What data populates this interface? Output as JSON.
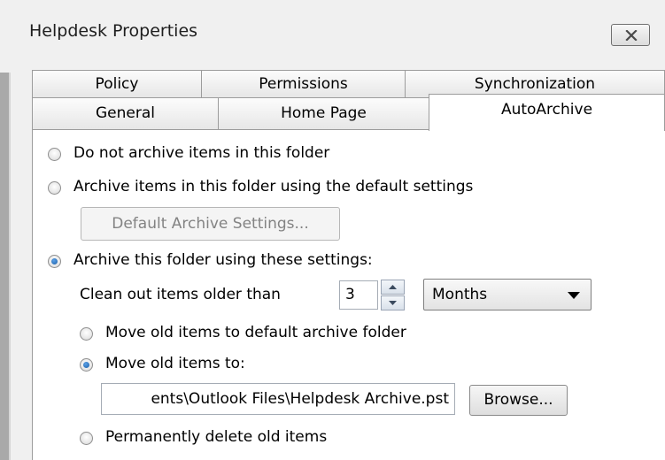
{
  "window": {
    "title": "Helpdesk Properties",
    "close_icon": "close-icon"
  },
  "tabs": {
    "row1": [
      "Policy",
      "Permissions",
      "Synchronization"
    ],
    "row2": [
      "General",
      "Home Page",
      "AutoArchive"
    ],
    "active": "AutoArchive"
  },
  "autoarchive": {
    "option_no_archive": "Do not archive items in this folder",
    "option_default": "Archive items in this folder using the default settings",
    "default_settings_button": "Default Archive Settings...",
    "option_custom": "Archive this folder using these settings:",
    "clean_out_label": "Clean out items older than",
    "age_value": "3",
    "age_unit": "Months",
    "move_default_label": "Move old items to default archive folder",
    "move_to_label": "Move old items to:",
    "archive_path": "ents\\Outlook Files\\Helpdesk Archive.pst",
    "browse_button": "Browse...",
    "delete_label": "Permanently delete old items",
    "selected_option": "option_custom",
    "selected_move": "move_to"
  },
  "colors": {
    "radio_checked": "#1c5fa8",
    "panel_bg": "#ffffff",
    "window_bg": "#f0f0f0"
  }
}
